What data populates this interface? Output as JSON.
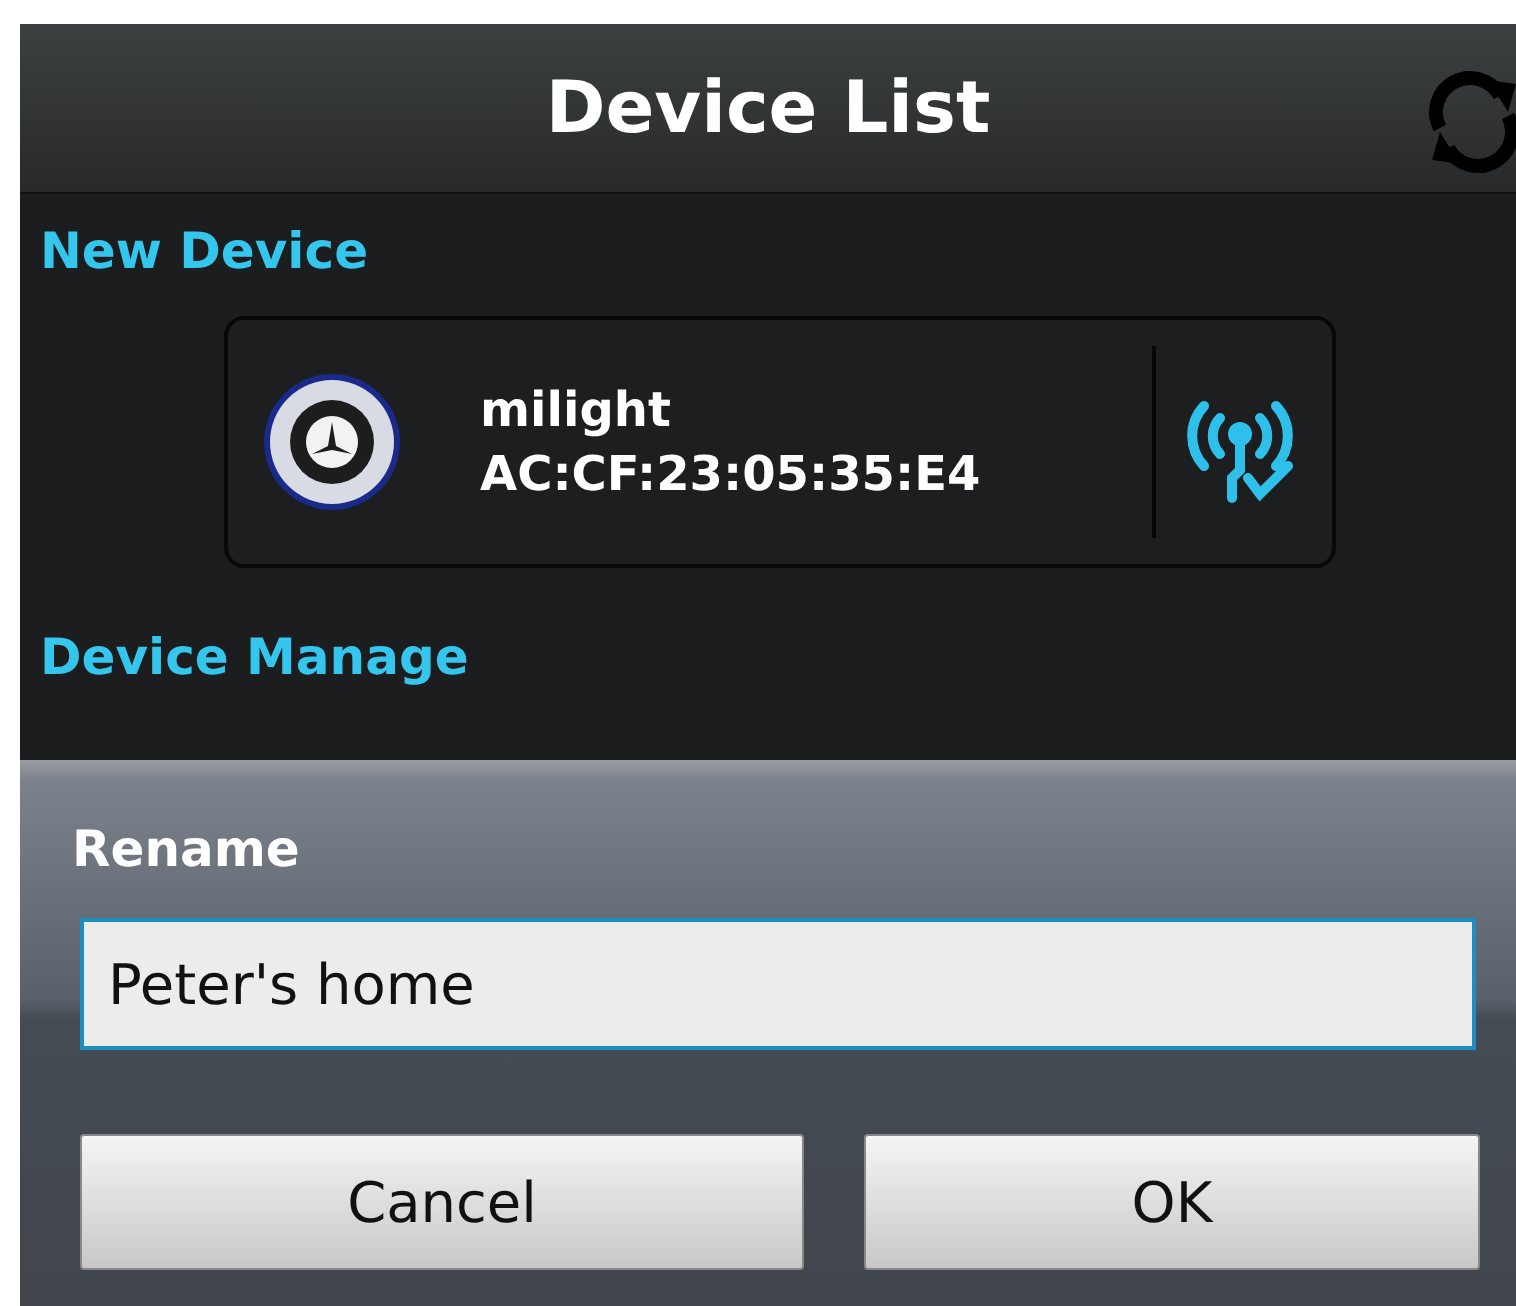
{
  "title_bar": {
    "title": "Device List"
  },
  "new_device": {
    "heading": "New Device",
    "devices": [
      {
        "name": "milight",
        "mac": "AC:CF:23:05:35:E4"
      }
    ]
  },
  "device_manage": {
    "heading": "Device Manage"
  },
  "rename_dialog": {
    "title": "Rename",
    "value": "Peter's home",
    "buttons": [
      "Cancel",
      "OK"
    ]
  }
}
